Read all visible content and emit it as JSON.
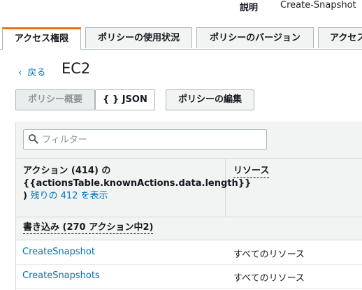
{
  "header": {
    "description_label": "説明",
    "description_value": "Create-Snapshot"
  },
  "tabs": [
    {
      "label": "アクセス権限",
      "active": true
    },
    {
      "label": "ポリシーの使用状況",
      "active": false
    },
    {
      "label": "ポリシーのバージョン",
      "active": false
    },
    {
      "label": "アクセス",
      "active": false
    }
  ],
  "nav": {
    "back_label": "戻る",
    "service_title": "EC2"
  },
  "toolbar": {
    "summary_label": "ポリシー概要",
    "json_label": "{ } JSON",
    "edit_label": "ポリシーの編集"
  },
  "filter": {
    "placeholder": "フィルター",
    "value": ""
  },
  "table": {
    "actions_header_prefix": "アクション (414) の",
    "actions_header_template": "{{actionsTable.knownActions.data.length}}",
    "actions_header_suffix": ")",
    "show_remaining_link": "残りの 412 を表示",
    "resource_header": "リソース",
    "group_label": "書き込み (270 アクション中2)",
    "rows": [
      {
        "action": "CreateSnapshot",
        "resource": "すべてのリソース"
      },
      {
        "action": "CreateSnapshots",
        "resource": "すべてのリソース"
      }
    ]
  },
  "colors": {
    "accent": "#ec7211",
    "link": "#0073bb",
    "header_bg": "#f2f3f3"
  }
}
